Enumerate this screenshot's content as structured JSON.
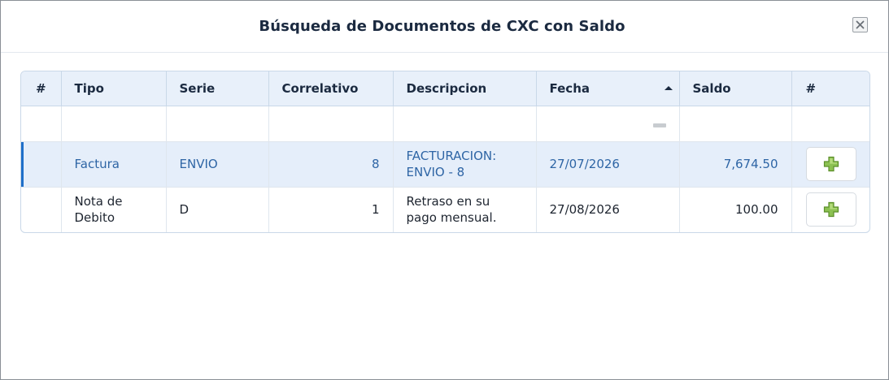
{
  "dialog": {
    "title": "Búsqueda de Documentos de CXC con Saldo",
    "close_icon": "close-icon"
  },
  "table": {
    "columns": [
      "#",
      "Tipo",
      "Serie",
      "Correlativo",
      "Descripcion",
      "Fecha",
      "Saldo",
      "#"
    ],
    "sorted_column": "Fecha",
    "sort_direction": "ascending",
    "rows": [
      {
        "tipo": "Factura",
        "serie": "ENVIO",
        "correlativo": "8",
        "descripcion": "FACTURACION: ENVIO - 8",
        "fecha": "27/07/2026",
        "saldo": "7,674.50",
        "action_icon": "plus-icon",
        "selected": true
      },
      {
        "tipo": "Nota de Debito",
        "serie": "D",
        "correlativo": "1",
        "descripcion": "Retraso en su pago mensual.",
        "fecha": "27/08/2026",
        "saldo": "100.00",
        "action_icon": "plus-icon",
        "selected": false
      }
    ]
  },
  "colors": {
    "header_bg": "#e8f0fa",
    "selected_row_bg": "#e5eefa",
    "selected_text": "#2e65a5",
    "accent": "#1f6fc9",
    "add_icon": "#7cb342"
  }
}
